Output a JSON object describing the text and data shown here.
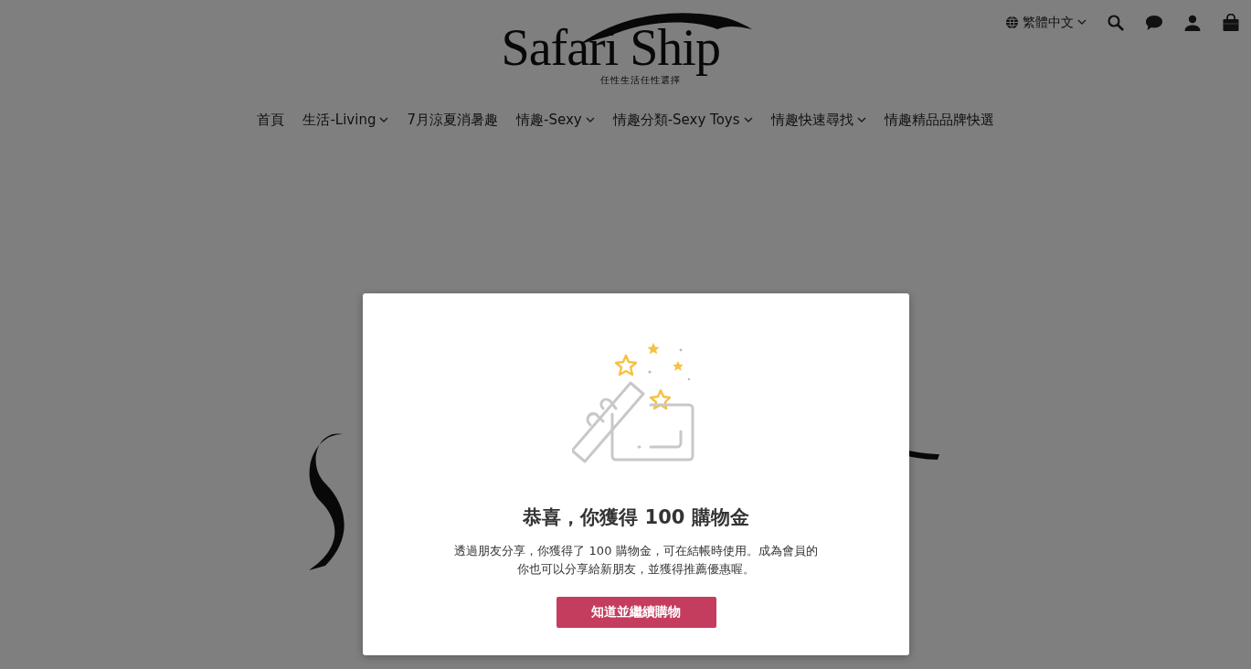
{
  "header": {
    "logo": {
      "wordmark": "Safari Ship",
      "tagline": "任性生活任性選擇"
    },
    "language": "繁體中文"
  },
  "nav": [
    {
      "label": "首頁",
      "dropdown": false
    },
    {
      "label": "生活-Living",
      "dropdown": true
    },
    {
      "label": "7月涼夏消暑趣",
      "dropdown": false
    },
    {
      "label": "情趣-Sexy",
      "dropdown": true
    },
    {
      "label": "情趣分類-Sexy Toys",
      "dropdown": true
    },
    {
      "label": "情趣快速尋找",
      "dropdown": true
    },
    {
      "label": "情趣精品品牌快選",
      "dropdown": false
    }
  ],
  "modal": {
    "title": "恭喜，你獲得 100 購物金",
    "message_lines": [
      "透過朋友分享，你獲得了 100 購物金，可在結帳時使用。成為會員的",
      "你也可以分享給新朋友，並獲得推薦優惠喔。"
    ],
    "button": "知道並繼續購物"
  }
}
